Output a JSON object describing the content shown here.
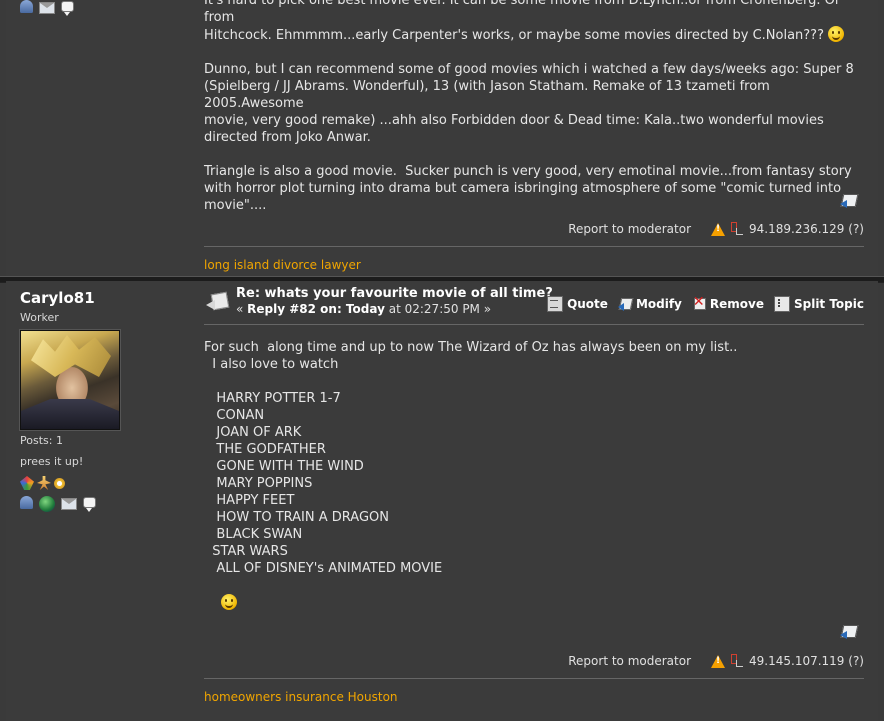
{
  "post1": {
    "body_lines": [
      "It's hard to pick one best movie ever. It can be some movie from D.Lynch..or from Cronenberg. Or from",
      "Hitchcock. Ehmmmm...early Carpenter's works, or maybe some movies directed by C.Nolan??? ",
      "",
      "Dunno, but I can recommend some of good movies which i watched a few days/weeks ago: Super 8",
      "(Spielberg / JJ Abrams. Wonderful), 13 (with Jason Statham. Remake of 13 tzameti from 2005.Awesome",
      "movie, very good remake) ...ahh also Forbidden door & Dead time: Kala..two wonderful movies",
      "directed from Joko Anwar.",
      "",
      "Triangle is also a good movie.  Sucker punch is very good, very emotinal movie...from fantasy story",
      "with horror plot turning into drama but camera isbringing atmosphere of some \"comic turned into",
      "movie\"...."
    ],
    "report_label": "Report to moderator",
    "ip": "94.189.236.129 (?)",
    "signature": "long island divorce lawyer"
  },
  "post2": {
    "author": "Carylo81",
    "rank": "Worker",
    "posts": "Posts: 1",
    "personal_text": "prees it up!",
    "subject": "Re: whats your favourite movie of all time?",
    "reply_prefix": "« ",
    "reply_bold": "Reply #82 on: Today",
    "reply_time": " at 02:27:50 PM »",
    "actions": {
      "quote": "Quote",
      "modify": "Modify",
      "remove": "Remove",
      "split": "Split Topic"
    },
    "body_lines": [
      "For such  along time and up to now The Wizard of Oz has always been on my list..",
      "  I also love to watch",
      "",
      "   HARRY POTTER 1-7",
      "   CONAN",
      "   JOAN OF ARK",
      "   THE GODFATHER",
      "   GONE WITH THE WIND",
      "   MARY POPPINS",
      "   HAPPY FEET",
      "   HOW TO TRAIN A DRAGON",
      "   BLACK SWAN",
      "  STAR WARS",
      "   ALL OF DISNEY's ANIMATED MOVIE"
    ],
    "report_label": "Report to moderator",
    "ip": "49.145.107.119 (?)",
    "signature": "homeowners insurance Houston"
  }
}
